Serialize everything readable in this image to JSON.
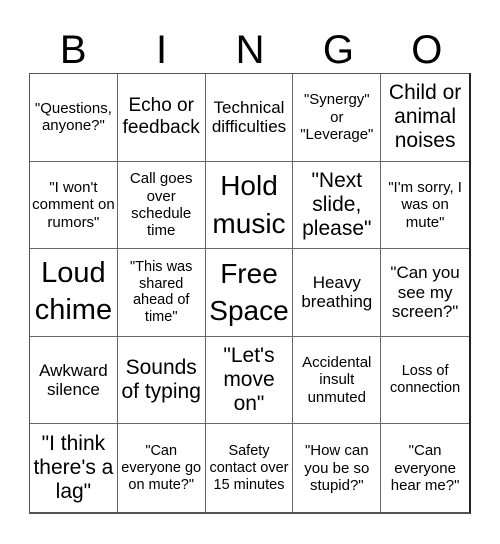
{
  "header": [
    "B",
    "I",
    "N",
    "G",
    "O"
  ],
  "cells": [
    "\"Questions, anyone?\"",
    "Echo or feedback",
    "Technical difficulties",
    "\"Synergy\" or \"Leverage\"",
    "Child or animal noises",
    "\"I won't comment on rumors\"",
    "Call goes over schedule time",
    "Hold music",
    "\"Next slide, please\"",
    "\"I'm sorry, I was on mute\"",
    "Loud chime",
    "\"This was shared ahead of time\"",
    "Free Space",
    "Heavy breathing",
    "\"Can you see my screen?\"",
    "Awkward silence",
    "Sounds of typing",
    "\"Let's move on\"",
    "Accidental insult unmuted",
    "Loss of connection",
    "\"I think there's a lag\"",
    "\"Can everyone go on mute?\"",
    "Safety contact over 15 minutes",
    "\"How can you be so stupid?\"",
    "\"Can everyone hear me?\""
  ]
}
